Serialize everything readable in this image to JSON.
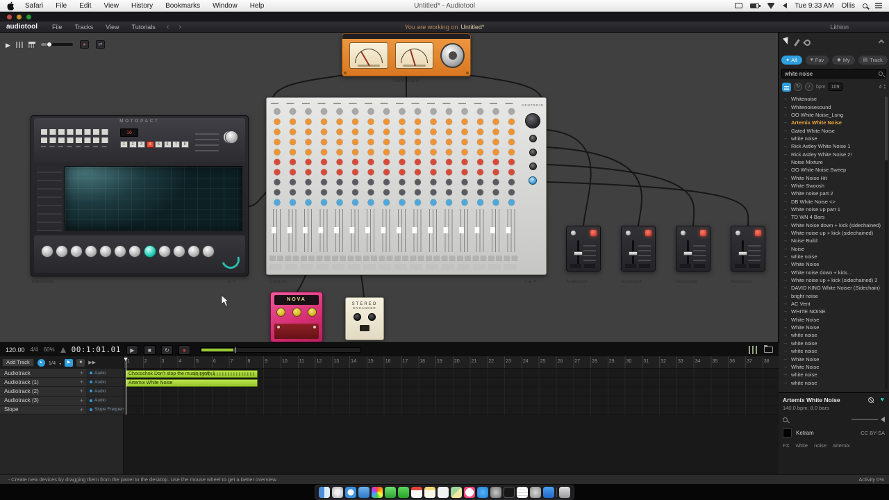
{
  "colors": {
    "accent_blue": "#2f9fdf",
    "accent_teal": "#2bd4c0",
    "accent_orange": "#ef9434",
    "clip_green": "#a8d63a",
    "active_result": "#eca53c"
  },
  "menubar": {
    "menus": [
      "Safari",
      "File",
      "Edit",
      "View",
      "History",
      "Bookmarks",
      "Window",
      "Help"
    ],
    "window_title": "Untitled* - Audiotool",
    "time": "Tue 9:33 AM",
    "user": "Ollis"
  },
  "appbar": {
    "logo": "audiotool",
    "menus": [
      "File",
      "Tracks",
      "View",
      "Tutorials"
    ],
    "back": "‹",
    "forward": "›",
    "working_prefix": "You are working on",
    "working_doc": "Untitled*",
    "remote_user": "Lithion"
  },
  "desktop": {
    "output": {
      "label": "stereo output"
    },
    "machiniste": {
      "title": "MOTOPACT",
      "label": "Machiniste",
      "length_value": "16",
      "steps": [
        {
          "label": "1"
        },
        {
          "label": "2"
        },
        {
          "label": "3"
        },
        {
          "label": "4",
          "active": true
        },
        {
          "label": "5"
        },
        {
          "label": "6"
        },
        {
          "label": "7"
        },
        {
          "label": "8"
        }
      ],
      "knob_count": 12,
      "accent_knob": 7
    },
    "mixer": {
      "label": "Centroid",
      "brand": "CENTROID",
      "channel_count": 16,
      "knob_bands": [
        {
          "color": "#a8a8a8",
          "rows": 1
        },
        {
          "color": "#ef9434",
          "rows": 4
        },
        {
          "color": "#d84a38",
          "rows": 2
        },
        {
          "color": "#5a5a60",
          "rows": 2
        },
        {
          "color": "#4fa8dc",
          "rows": 1
        }
      ]
    },
    "audiotracks": [
      {
        "label": "Audiotrack"
      },
      {
        "label": "Audiotrack"
      },
      {
        "label": "Audiotrack"
      },
      {
        "label": "Audiotrack"
      }
    ],
    "nova": {
      "title": "NOVA"
    },
    "enhancer": {
      "title_line1": "STEREO",
      "title_line2": "ENHANCER"
    }
  },
  "transport": {
    "bpm": "120.00",
    "signature": "4/4",
    "shuffle": "60%",
    "time": "00:1:01.01"
  },
  "timeline": {
    "add_track": "Add Track",
    "quantize": "1/4",
    "ruler_numbers": [
      1,
      2,
      3,
      4,
      5,
      6,
      7,
      8,
      9,
      10,
      11,
      12,
      13,
      14,
      15,
      16,
      17,
      18,
      19,
      20,
      21,
      22,
      23,
      24,
      25,
      26,
      27,
      28,
      29,
      30,
      31,
      32,
      33,
      34,
      35,
      36,
      37,
      38
    ],
    "tracks": [
      {
        "name": "Audiotrack",
        "badge": "Audio"
      },
      {
        "name": "Audiotrack (1)",
        "badge": "Audio"
      },
      {
        "name": "Audiotrack (2)",
        "badge": "Audio"
      },
      {
        "name": "Audiotrack (3)",
        "badge": "Audio"
      },
      {
        "name": "Slope",
        "badge": "Slope Frequency"
      }
    ],
    "clips": [
      {
        "label": "Chocochok Don't stop the music synth 1",
        "track": 0
      },
      {
        "label": "Artemix White Noise",
        "track": 1
      }
    ]
  },
  "statusbar": {
    "tip": "- Create new devices by dragging them from the panel to the desktop. Use the mouse wheel to get a better overview.",
    "activity": "Activity 0%"
  },
  "sidebar": {
    "tabs": [
      {
        "label": "All",
        "icon": "●",
        "active": true
      },
      {
        "label": "Fav",
        "icon": "♥"
      },
      {
        "label": "My",
        "icon": "◆"
      },
      {
        "label": "Track",
        "icon": "▤"
      }
    ],
    "search_value": "white noise",
    "loop_icon": "↻",
    "note_icon": "♪",
    "bpm_label": "bpm",
    "bpm_value": "109",
    "bars_value": "4",
    "results": [
      {
        "label": "Whitenoise"
      },
      {
        "label": "Whitenoisesound"
      },
      {
        "label": "OO White Noise_Long"
      },
      {
        "label": "Artemix White Noise",
        "active": true
      },
      {
        "label": "Gated White Noise"
      },
      {
        "label": "white noise"
      },
      {
        "label": "Rick Astley White Noise 1"
      },
      {
        "label": "Rick Astley White Noise 2!"
      },
      {
        "label": "Noise Mixture"
      },
      {
        "label": "OO White Noise Sweep"
      },
      {
        "label": "White Noise Hit"
      },
      {
        "label": "White Swoosh"
      },
      {
        "label": "White noise part 2"
      },
      {
        "label": "DB White Noise <>"
      },
      {
        "label": "White noise up part 1"
      },
      {
        "label": "TD WN 4 Bars"
      },
      {
        "label": "White Noise down + kick (sidechained)"
      },
      {
        "label": "White noise up + kick (sidechained)"
      },
      {
        "label": "Noise Build"
      },
      {
        "label": "Noise"
      },
      {
        "label": "white noise"
      },
      {
        "label": "White Noise"
      },
      {
        "label": "White noise down + kick..."
      },
      {
        "label": "White noise up + kick (sidechained) 2"
      },
      {
        "label": "DAVID KING White Noiser (Sidechain)"
      },
      {
        "label": "bright noise"
      },
      {
        "label": "AC Vent"
      },
      {
        "label": "WHITE NOISE"
      },
      {
        "label": "White Noise"
      },
      {
        "label": "White Noise"
      },
      {
        "label": "white noise"
      },
      {
        "label": "white noise"
      },
      {
        "label": "white noise"
      },
      {
        "label": "White Noise"
      },
      {
        "label": "White Noise"
      },
      {
        "label": "white noise"
      },
      {
        "label": "white noise"
      }
    ],
    "details": {
      "title": "Artemix White Noise",
      "meta": "140.0 bpm, 8.0 bars",
      "author": "Ketram",
      "license": "CC BY-SA",
      "tags": [
        "FX",
        "white",
        "noise",
        "artemix"
      ]
    }
  },
  "dock": {
    "items": [
      {
        "icon": "finder"
      },
      {
        "icon": "launchpad"
      },
      {
        "icon": "safari"
      },
      {
        "icon": "mail"
      },
      {
        "icon": "photos"
      },
      {
        "icon": "messages"
      },
      {
        "icon": "facetime"
      },
      {
        "icon": "calendar"
      },
      {
        "icon": "notes"
      },
      {
        "icon": "reminders"
      },
      {
        "icon": "maps"
      },
      {
        "icon": "music"
      },
      {
        "icon": "appstore"
      },
      {
        "icon": "preferences"
      },
      {
        "icon": "terminal"
      },
      {
        "icon": "textedit"
      },
      {
        "icon": "downloads"
      },
      {
        "icon": "dropbox"
      },
      {
        "icon": "trash"
      }
    ]
  }
}
